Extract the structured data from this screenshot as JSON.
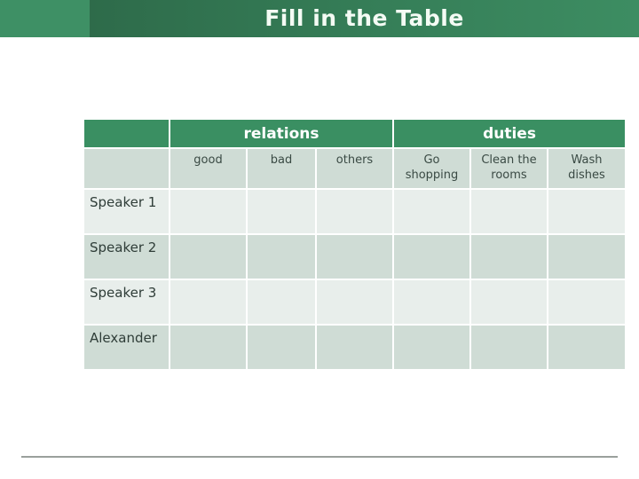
{
  "title": "Fill in the Table",
  "table": {
    "groups": [
      {
        "label": "relations"
      },
      {
        "label": "duties"
      }
    ],
    "subheaders": [
      "good",
      "bad",
      "others",
      "Go shopping",
      "Clean the rooms",
      "Wash dishes"
    ],
    "rows": [
      {
        "label": "Speaker 1"
      },
      {
        "label": "Speaker 2"
      },
      {
        "label": "Speaker 3"
      },
      {
        "label": "Alexander"
      }
    ]
  },
  "colors": {
    "header_green": "#3a8f62",
    "title_green": "#2e6b4a",
    "row_light": "#e8eeeb",
    "row_dark": "#cfdcd5"
  }
}
